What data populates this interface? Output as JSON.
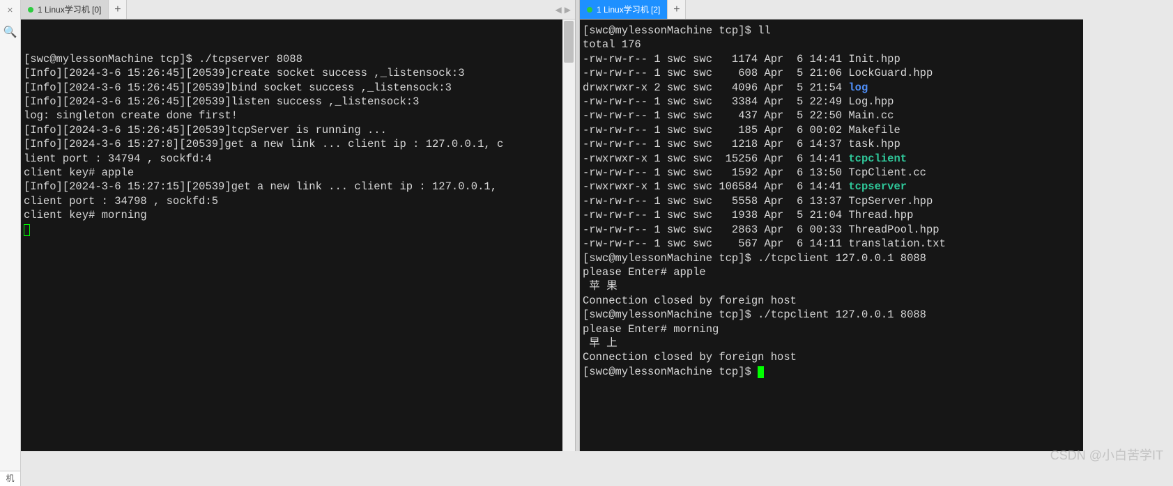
{
  "toolbar": {
    "close_glyph": "×",
    "search_glyph": "🔍"
  },
  "bottom_tab": "机",
  "watermark": "CSDN @小白苦学IT",
  "tabs": {
    "left": {
      "label": "1 Linux学习机 [0]",
      "add": "+",
      "nav_left": "◀",
      "nav_right": "▶"
    },
    "right": {
      "label": "1 Linux学习机 [2]",
      "add": "+"
    }
  },
  "term_left": {
    "lines": [
      {
        "t": "[swc@mylessonMachine tcp]$ ./tcpserver 8088"
      },
      {
        "t": "[Info][2024-3-6 15:26:45][20539]create socket success ,_listensock:3"
      },
      {
        "t": "[Info][2024-3-6 15:26:45][20539]bind socket success ,_listensock:3"
      },
      {
        "t": "[Info][2024-3-6 15:26:45][20539]listen success ,_listensock:3"
      },
      {
        "t": "log: singleton create done first!"
      },
      {
        "t": "[Info][2024-3-6 15:26:45][20539]tcpServer is running ..."
      },
      {
        "t": "[Info][2024-3-6 15:27:8][20539]get a new link ... client ip : 127.0.0.1, c"
      },
      {
        "t": "lient port : 34794 , sockfd:4"
      },
      {
        "t": "client key# apple"
      },
      {
        "t": "[Info][2024-3-6 15:27:15][20539]get a new link ... client ip : 127.0.0.1, "
      },
      {
        "t": "client port : 34798 , sockfd:5"
      },
      {
        "t": "client key# morning"
      }
    ]
  },
  "term_right": {
    "prompt1": "[swc@mylessonMachine tcp]$ ll",
    "total": "total 176",
    "files": [
      {
        "perm": "-rw-rw-r--",
        "n": "1",
        "o": "swc",
        "g": "swc",
        "size": "  1174",
        "date": "Apr  6 14:41",
        "name": "Init.hpp",
        "cls": ""
      },
      {
        "perm": "-rw-rw-r--",
        "n": "1",
        "o": "swc",
        "g": "swc",
        "size": "   608",
        "date": "Apr  5 21:06",
        "name": "LockGuard.hpp",
        "cls": ""
      },
      {
        "perm": "drwxrwxr-x",
        "n": "2",
        "o": "swc",
        "g": "swc",
        "size": "  4096",
        "date": "Apr  5 21:54",
        "name": "log",
        "cls": "blue"
      },
      {
        "perm": "-rw-rw-r--",
        "n": "1",
        "o": "swc",
        "g": "swc",
        "size": "  3384",
        "date": "Apr  5 22:49",
        "name": "Log.hpp",
        "cls": ""
      },
      {
        "perm": "-rw-rw-r--",
        "n": "1",
        "o": "swc",
        "g": "swc",
        "size": "   437",
        "date": "Apr  5 22:50",
        "name": "Main.cc",
        "cls": ""
      },
      {
        "perm": "-rw-rw-r--",
        "n": "1",
        "o": "swc",
        "g": "swc",
        "size": "   185",
        "date": "Apr  6 00:02",
        "name": "Makefile",
        "cls": ""
      },
      {
        "perm": "-rw-rw-r--",
        "n": "1",
        "o": "swc",
        "g": "swc",
        "size": "  1218",
        "date": "Apr  6 14:37",
        "name": "task.hpp",
        "cls": ""
      },
      {
        "perm": "-rwxrwxr-x",
        "n": "1",
        "o": "swc",
        "g": "swc",
        "size": " 15256",
        "date": "Apr  6 14:41",
        "name": "tcpclient",
        "cls": "exec"
      },
      {
        "perm": "-rw-rw-r--",
        "n": "1",
        "o": "swc",
        "g": "swc",
        "size": "  1592",
        "date": "Apr  6 13:50",
        "name": "TcpClient.cc",
        "cls": ""
      },
      {
        "perm": "-rwxrwxr-x",
        "n": "1",
        "o": "swc",
        "g": "swc",
        "size": "106584",
        "date": "Apr  6 14:41",
        "name": "tcpserver",
        "cls": "exec"
      },
      {
        "perm": "-rw-rw-r--",
        "n": "1",
        "o": "swc",
        "g": "swc",
        "size": "  5558",
        "date": "Apr  6 13:37",
        "name": "TcpServer.hpp",
        "cls": ""
      },
      {
        "perm": "-rw-rw-r--",
        "n": "1",
        "o": "swc",
        "g": "swc",
        "size": "  1938",
        "date": "Apr  5 21:04",
        "name": "Thread.hpp",
        "cls": ""
      },
      {
        "perm": "-rw-rw-r--",
        "n": "1",
        "o": "swc",
        "g": "swc",
        "size": "  2863",
        "date": "Apr  6 00:33",
        "name": "ThreadPool.hpp",
        "cls": ""
      },
      {
        "perm": "-rw-rw-r--",
        "n": "1",
        "o": "swc",
        "g": "swc",
        "size": "   567",
        "date": "Apr  6 14:11",
        "name": "translation.txt",
        "cls": ""
      }
    ],
    "tail": [
      "[swc@mylessonMachine tcp]$ ./tcpclient 127.0.0.1 8088",
      "please Enter# apple",
      " 苹 果 ",
      "Connection closed by foreign host",
      "[swc@mylessonMachine tcp]$ ./tcpclient 127.0.0.1 8088",
      "please Enter# morning",
      " 早 上 ",
      "Connection closed by foreign host"
    ],
    "final_prompt": "[swc@mylessonMachine tcp]$ "
  }
}
